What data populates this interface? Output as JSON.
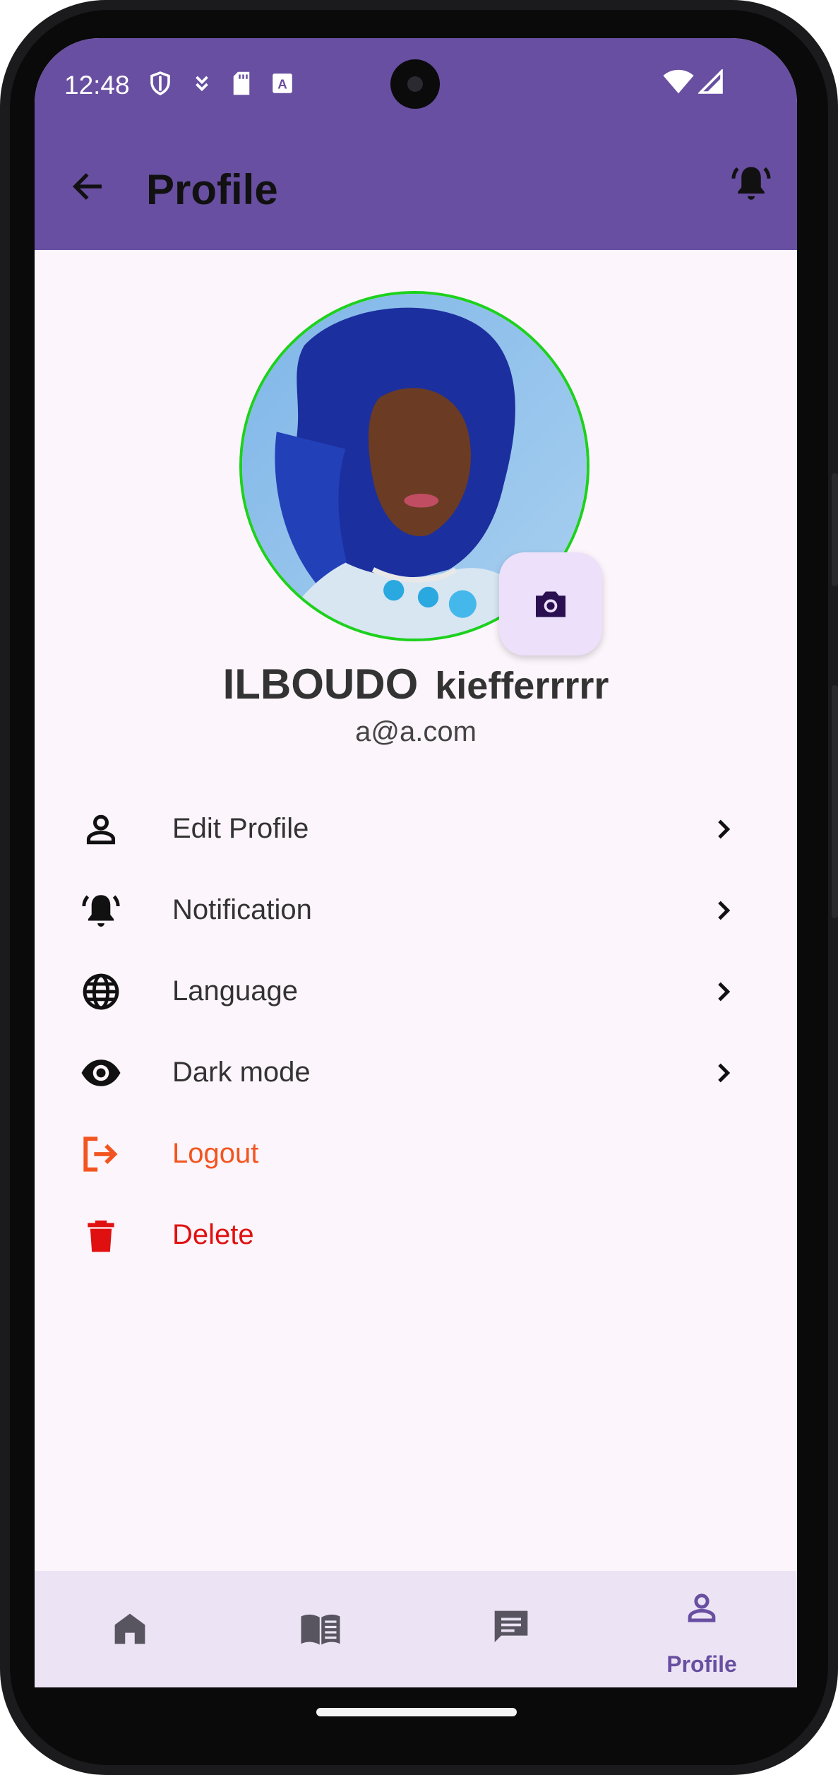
{
  "status_bar": {
    "time": "12:48",
    "left_icons": [
      "shield-icon",
      "download-icon",
      "sd-card-icon",
      "font-a-icon"
    ],
    "right_icons": [
      "wifi-icon",
      "cell-signal-icon"
    ]
  },
  "app_bar": {
    "back_icon": "arrow-back-icon",
    "title": "Profile",
    "action_icon": "notification-bell-icon"
  },
  "profile": {
    "last_name": "ILBOUDO",
    "first_name": "kiefferrrrr",
    "email": "a@a.com",
    "avatar_border_color": "#1dd11d",
    "camera_icon": "camera-icon"
  },
  "menu": {
    "items": [
      {
        "label": "Edit Profile",
        "icon": "person-outline-icon",
        "color": "#333333"
      },
      {
        "label": "Notification",
        "icon": "notification-bell-icon",
        "color": "#333333"
      },
      {
        "label": "Language",
        "icon": "globe-icon",
        "color": "#333333"
      },
      {
        "label": "Dark mode",
        "icon": "eye-icon",
        "color": "#333333"
      },
      {
        "label": "Logout",
        "icon": "logout-icon",
        "color": "#f2551f"
      },
      {
        "label": "Delete",
        "icon": "trash-icon",
        "color": "#e01010"
      }
    ]
  },
  "bottom_nav": {
    "items": [
      {
        "icon": "home-icon",
        "label": ""
      },
      {
        "icon": "book-icon",
        "label": ""
      },
      {
        "icon": "chat-icon",
        "label": ""
      },
      {
        "icon": "person-outline-icon",
        "label": "Profile",
        "selected": true
      }
    ]
  },
  "colors": {
    "primary": "#684fa1",
    "background": "#fcf5fb",
    "nav_background": "#ece4f4",
    "logout": "#f2551f",
    "delete": "#e01010"
  }
}
